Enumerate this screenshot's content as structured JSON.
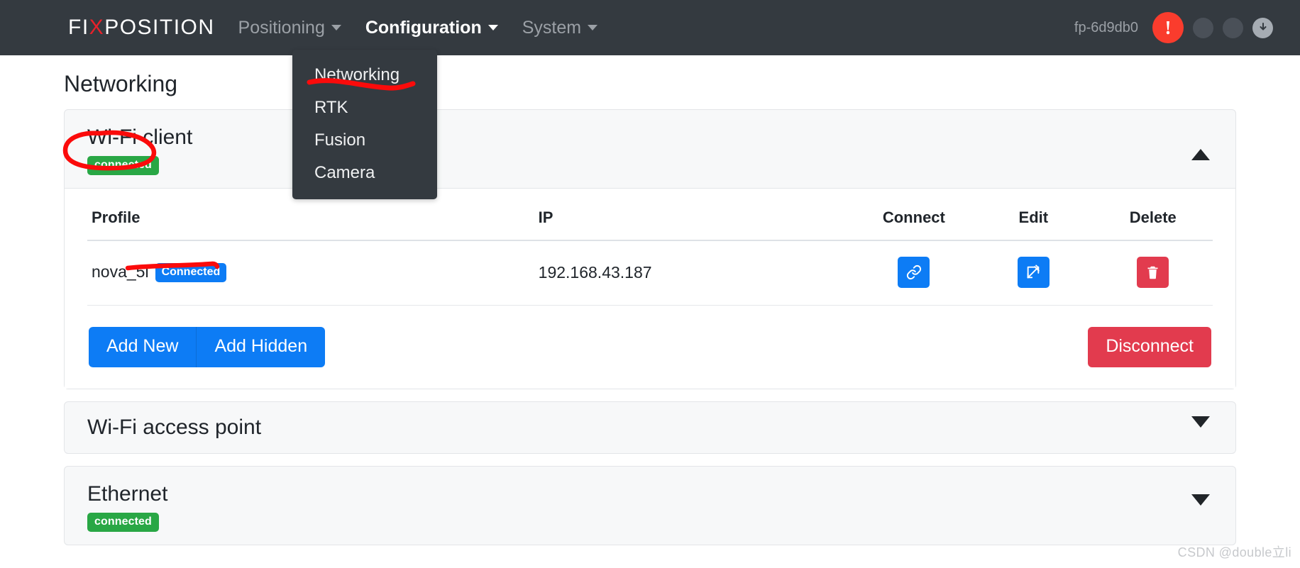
{
  "navbar": {
    "brand_pre": "FI",
    "brand_x": "X",
    "brand_post": "POSITION",
    "items": [
      {
        "label": "Positioning",
        "active": false,
        "caret": "chevron-down-icon"
      },
      {
        "label": "Configuration",
        "active": true,
        "caret": "chevron-down-icon"
      },
      {
        "label": "System",
        "active": false,
        "caret": "chevron-down-icon"
      }
    ],
    "device_id": "fp-6d9db0",
    "alert_glyph": "!",
    "status_icons": [
      "status-dot-1",
      "status-dot-2",
      "download-icon"
    ],
    "background": "#343a40"
  },
  "dropdown": {
    "open_for": "Configuration",
    "items": [
      {
        "label": "Networking"
      },
      {
        "label": "RTK"
      },
      {
        "label": "Fusion"
      },
      {
        "label": "Camera"
      }
    ]
  },
  "page": {
    "title": "Networking"
  },
  "wifi_client": {
    "title": "Wi-Fi client",
    "status_badge": "connected",
    "status_color": "#29a745",
    "expanded": true,
    "collapse_icon": "chevron-up-icon",
    "table": {
      "headers": [
        "Profile",
        "IP",
        "Connect",
        "Edit",
        "Delete"
      ],
      "rows": [
        {
          "profile": "nova_5i",
          "profile_badge": "Connected",
          "profile_badge_color": "#0d7cf5",
          "ip": "192.168.43.187",
          "connect_icon": "link-icon",
          "edit_icon": "edit-pencil-icon",
          "delete_icon": "trash-icon"
        }
      ]
    },
    "actions": {
      "add_new": "Add New",
      "add_hidden": "Add Hidden",
      "disconnect": "Disconnect",
      "primary_color": "#0d7cf5",
      "danger_color": "#e23b4e"
    }
  },
  "wifi_ap": {
    "title": "Wi-Fi access point",
    "expanded": false,
    "collapse_icon": "chevron-down-icon"
  },
  "ethernet": {
    "title": "Ethernet",
    "status_badge": "connected",
    "status_color": "#29a745",
    "expanded": false,
    "collapse_icon": "chevron-down-icon"
  },
  "annotations": {
    "color": "#fb0b0b",
    "marks": [
      {
        "name": "circle-around-connected-badge"
      },
      {
        "name": "underline-networking-menu-item"
      },
      {
        "name": "underline-connected-row-badge"
      }
    ]
  },
  "watermark": {
    "text": "CSDN @double立li"
  }
}
